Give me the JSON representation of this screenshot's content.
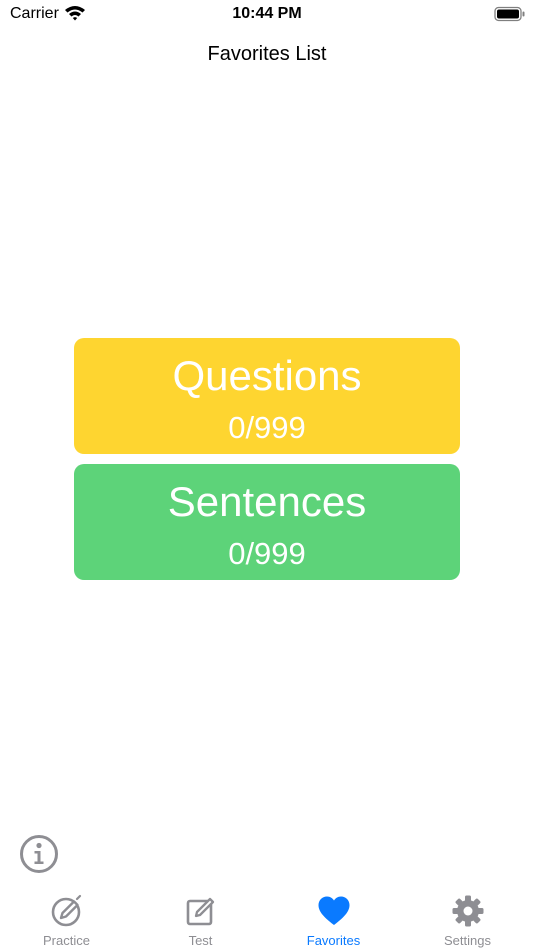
{
  "status_bar": {
    "carrier": "Carrier",
    "time": "10:44 PM"
  },
  "header": {
    "title": "Favorites List"
  },
  "cards": [
    {
      "title": "Questions",
      "count": "0/999",
      "color": "#fed530"
    },
    {
      "title": "Sentences",
      "count": "0/999",
      "color": "#5dd379"
    }
  ],
  "info": {
    "icon": "info-icon"
  },
  "tabs": [
    {
      "label": "Practice",
      "icon": "pencil-circle-icon",
      "active": false
    },
    {
      "label": "Test",
      "icon": "square-pencil-icon",
      "active": false
    },
    {
      "label": "Favorites",
      "icon": "heart-icon",
      "active": true
    },
    {
      "label": "Settings",
      "icon": "gear-icon",
      "active": false
    }
  ],
  "colors": {
    "accent": "#0a7aff",
    "inactive": "#8e8e93"
  }
}
